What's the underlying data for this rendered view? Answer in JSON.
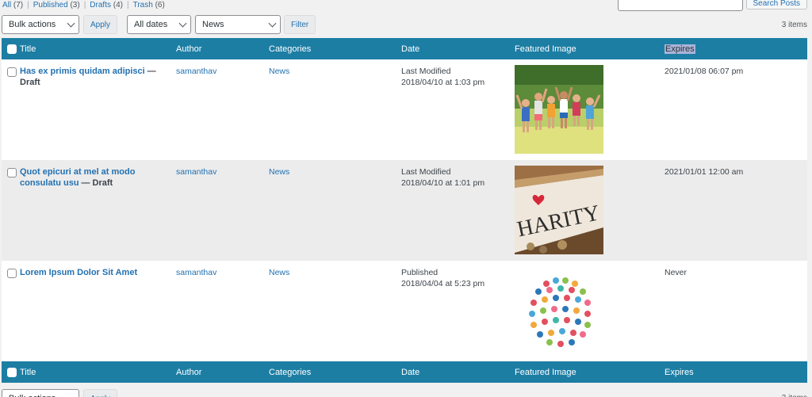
{
  "filters": {
    "all_label": "All",
    "all_count": "(7)",
    "published_label": "Published",
    "published_count": "(3)",
    "drafts_label": "Drafts",
    "drafts_count": "(4)",
    "trash_label": "Trash",
    "trash_count": "(6)",
    "separator": "|"
  },
  "search": {
    "button_label": "Search Posts",
    "placeholder": ""
  },
  "toolbar": {
    "bulk_actions": "Bulk actions",
    "apply_label": "Apply",
    "dates": "All dates",
    "category": "News",
    "filter_label": "Filter",
    "items_count": "3 items"
  },
  "columns": {
    "title": "Title",
    "author": "Author",
    "categories": "Categories",
    "date": "Date",
    "featured_image": "Featured Image",
    "expires": "Expires"
  },
  "rows": [
    {
      "title": "Has ex primis quidam adipisci",
      "state": "— Draft",
      "author": "samanthav",
      "category": "News",
      "date_status": "Last Modified",
      "date": "2018/04/10 at 1:03 pm",
      "image": "children-jumping-park",
      "expires": "2021/01/08 06:07 pm"
    },
    {
      "title": "Quot epicuri at mel at modo consulatu usu",
      "state": "— Draft",
      "author": "samanthav",
      "category": "News",
      "date_status": "Last Modified",
      "date": "2018/04/10 at 1:01 pm",
      "image": "charity-jar",
      "expires": "2021/01/01 12:00 am"
    },
    {
      "title": "Lorem Ipsum Dolor Sit Amet",
      "state": "",
      "author": "samanthav",
      "category": "News",
      "date_status": "Published",
      "date": "2018/04/04 at 5:23 pm",
      "image": "charity-icons-circle",
      "expires": "Never"
    }
  ],
  "colors": {
    "header_bg": "#1d7ea4",
    "link": "#2271b1",
    "alt_row": "#ececec"
  }
}
